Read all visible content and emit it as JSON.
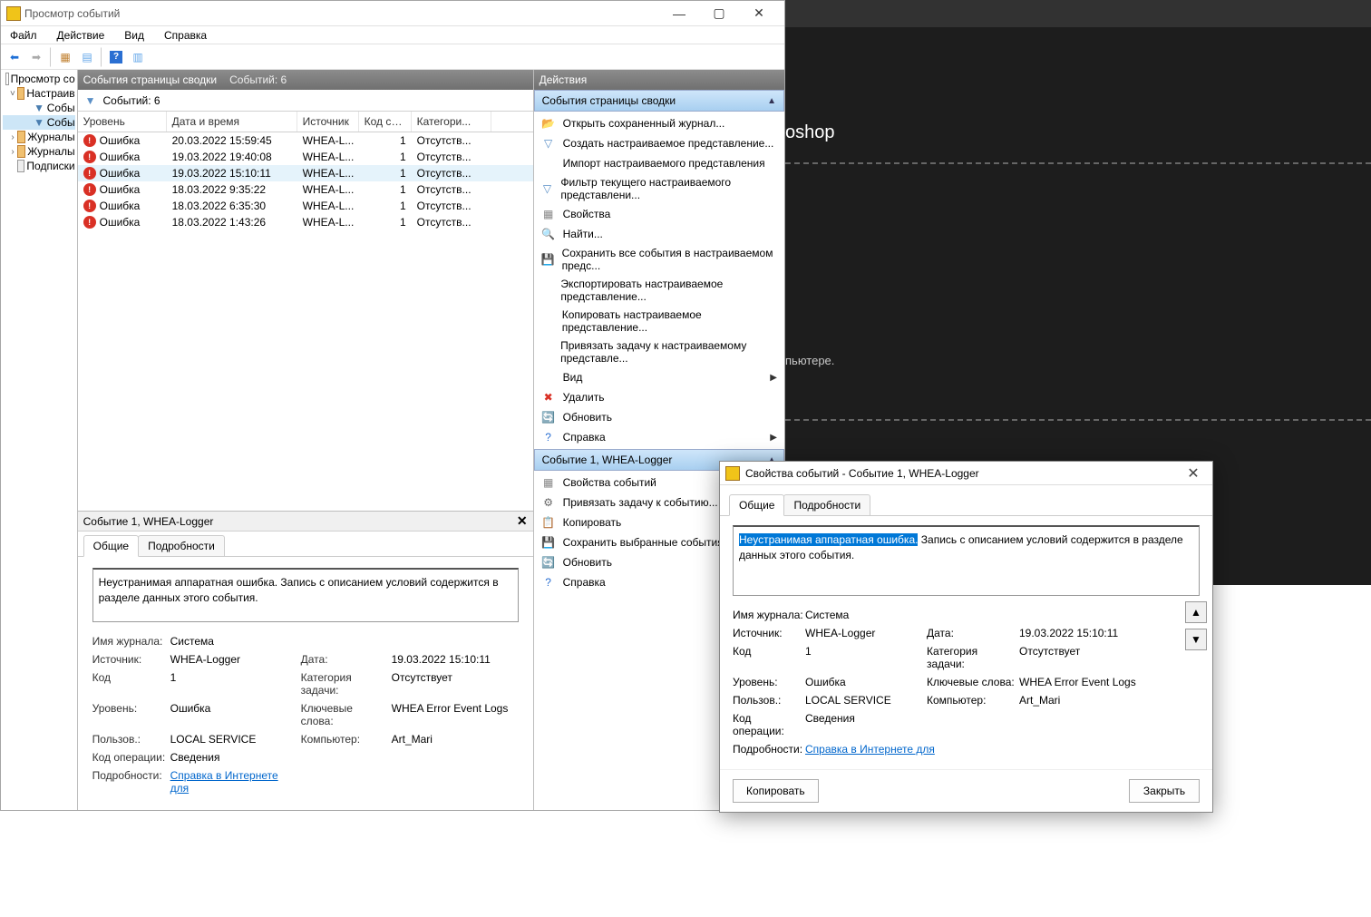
{
  "bg": {
    "photoshop": "oshop",
    "computerText": "пьютере."
  },
  "window": {
    "title": "Просмотр событий",
    "menu": [
      "Файл",
      "Действие",
      "Вид",
      "Справка"
    ]
  },
  "tree": {
    "root": "Просмотр со",
    "custom": "Настраив",
    "filt1": "Собы",
    "filt2": "Собы",
    "logs": "Журналы",
    "apps": "Журналы",
    "subs": "Подписки"
  },
  "center": {
    "header": "События страницы сводки",
    "countShort": "Событий: 6",
    "countSub": "Событий: 6",
    "cols": {
      "level": "Уровень",
      "date": "Дата и время",
      "src": "Источник",
      "code": "Код соб...",
      "cat": "Категори..."
    },
    "rows": [
      {
        "level": "Ошибка",
        "date": "20.03.2022 15:59:45",
        "src": "WHEA-L...",
        "code": "1",
        "cat": "Отсутств..."
      },
      {
        "level": "Ошибка",
        "date": "19.03.2022 19:40:08",
        "src": "WHEA-L...",
        "code": "1",
        "cat": "Отсутств..."
      },
      {
        "level": "Ошибка",
        "date": "19.03.2022 15:10:11",
        "src": "WHEA-L...",
        "code": "1",
        "cat": "Отсутств..."
      },
      {
        "level": "Ошибка",
        "date": "18.03.2022 9:35:22",
        "src": "WHEA-L...",
        "code": "1",
        "cat": "Отсутств..."
      },
      {
        "level": "Ошибка",
        "date": "18.03.2022 6:35:30",
        "src": "WHEA-L...",
        "code": "1",
        "cat": "Отсутств..."
      },
      {
        "level": "Ошибка",
        "date": "18.03.2022 1:43:26",
        "src": "WHEA-L...",
        "code": "1",
        "cat": "Отсутств..."
      }
    ]
  },
  "detail": {
    "title": "Событие 1, WHEA-Logger",
    "tabs": {
      "general": "Общие",
      "details": "Подробности"
    },
    "desc": "Неустранимая аппаратная ошибка. Запись с описанием условий содержится в разделе данных этого события.",
    "labels": {
      "log": "Имя журнала:",
      "src": "Источник:",
      "date": "Дата:",
      "code": "Код",
      "cat": "Категория задачи:",
      "level": "Уровень:",
      "keywords": "Ключевые слова:",
      "user": "Пользов.:",
      "computer": "Компьютер:",
      "opcode": "Код операции:",
      "moreinfo": "Подробности:"
    },
    "values": {
      "log": "Система",
      "src": "WHEA-Logger",
      "date": "19.03.2022 15:10:11",
      "code": "1",
      "cat": "Отсутствует",
      "level": "Ошибка",
      "keywords": "WHEA Error Event Logs",
      "user": "LOCAL SERVICE",
      "computer": "Art_Mari",
      "opcode": "Сведения",
      "link": "Справка в Интернете для"
    }
  },
  "actions": {
    "header": "Действия",
    "section1": "События страницы сводки",
    "items1": [
      "Открыть сохраненный журнал...",
      "Создать настраиваемое представление...",
      "Импорт настраиваемого представления",
      "Фильтр текущего настраиваемого представлени...",
      "Свойства",
      "Найти...",
      "Сохранить все события в настраиваемом предс...",
      "Экспортировать настраиваемое представление...",
      "Копировать настраиваемое представление...",
      "Привязать задачу к настраиваемому представле...",
      "Вид",
      "Удалить",
      "Обновить",
      "Справка"
    ],
    "section2": "Событие 1, WHEA-Logger",
    "items2": [
      "Свойства событий",
      "Привязать задачу к событию...",
      "Копировать",
      "Сохранить выбранные события...",
      "Обновить",
      "Справка"
    ]
  },
  "dialog": {
    "title": "Свойства событий - Событие 1, WHEA-Logger",
    "tabs": {
      "general": "Общие",
      "details": "Подробности"
    },
    "descHL": "Неустранимая аппаратная ошибка.",
    "descRest": " Запись с описанием условий содержится в разделе данных этого события.",
    "buttons": {
      "copy": "Копировать",
      "close": "Закрыть"
    }
  }
}
